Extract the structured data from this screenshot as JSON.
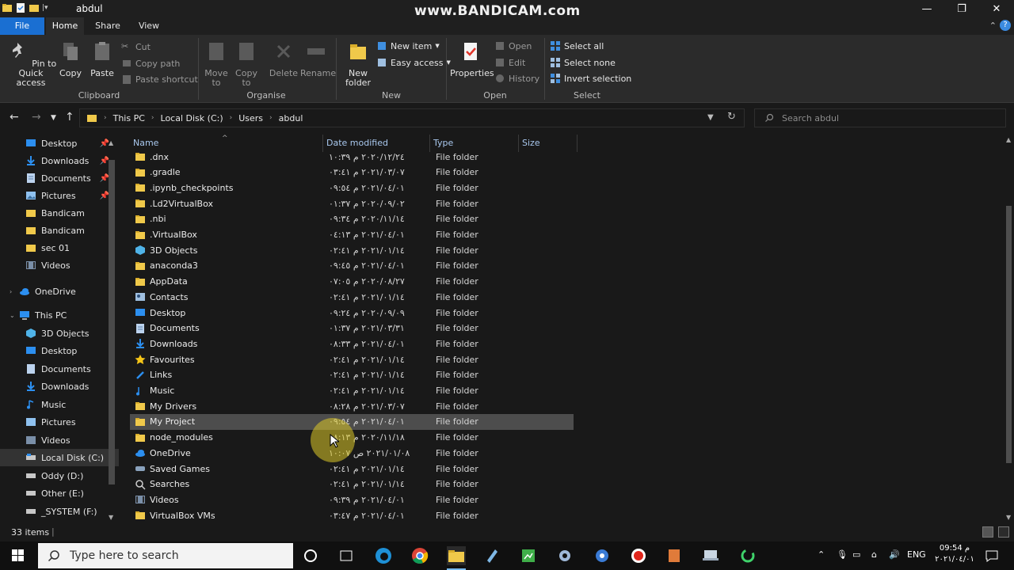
{
  "window": {
    "title": "abdul",
    "watermark": "www.BANDICAM.com",
    "minimize": "—",
    "restore": "❐",
    "close": "✕"
  },
  "tabs": {
    "file": "File",
    "home": "Home",
    "share": "Share",
    "view": "View"
  },
  "ribbon": {
    "clipboard": {
      "label": "Clipboard",
      "pin": "Pin to Quick access",
      "copy": "Copy",
      "paste": "Paste",
      "cut": "Cut",
      "copy_path": "Copy path",
      "paste_shortcut": "Paste shortcut"
    },
    "organise": {
      "label": "Organise",
      "move_to": "Move to",
      "copy_to": "Copy to",
      "delete": "Delete",
      "rename": "Rename"
    },
    "new": {
      "label": "New",
      "new_folder": "New folder",
      "new_item": "New item",
      "easy_access": "Easy access"
    },
    "open": {
      "label": "Open",
      "properties": "Properties",
      "open": "Open",
      "edit": "Edit",
      "history": "History"
    },
    "select": {
      "label": "Select",
      "select_all": "Select all",
      "select_none": "Select none",
      "invert": "Invert selection"
    }
  },
  "address": {
    "crumbs": [
      "This PC",
      "Local Disk (C:)",
      "Users",
      "abdul"
    ],
    "search_placeholder": "Search abdul"
  },
  "nav": {
    "quick_access": [
      {
        "label": "Desktop",
        "pinned": true,
        "icon": "desktop-icon"
      },
      {
        "label": "Downloads",
        "pinned": true,
        "icon": "downloads-icon"
      },
      {
        "label": "Documents",
        "pinned": true,
        "icon": "documents-icon"
      },
      {
        "label": "Pictures",
        "pinned": true,
        "icon": "pictures-icon"
      },
      {
        "label": "Bandicam",
        "pinned": false,
        "icon": "folder-icon"
      },
      {
        "label": "Bandicam",
        "pinned": false,
        "icon": "folder-icon"
      },
      {
        "label": "sec 01",
        "pinned": false,
        "icon": "folder-icon"
      },
      {
        "label": "Videos",
        "pinned": false,
        "icon": "videos-icon"
      }
    ],
    "onedrive": "OneDrive",
    "this_pc": "This PC",
    "this_pc_items": [
      {
        "label": "3D Objects",
        "icon": "3d-objects-icon"
      },
      {
        "label": "Desktop",
        "icon": "desktop-icon"
      },
      {
        "label": "Documents",
        "icon": "documents-icon"
      },
      {
        "label": "Downloads",
        "icon": "downloads-icon"
      },
      {
        "label": "Music",
        "icon": "music-icon"
      },
      {
        "label": "Pictures",
        "icon": "pictures-icon"
      },
      {
        "label": "Videos",
        "icon": "videos-icon"
      },
      {
        "label": "Local Disk (C:)",
        "icon": "drive-icon",
        "selected": true
      },
      {
        "label": "Oddy (D:)",
        "icon": "drive-icon"
      },
      {
        "label": "Other (E:)",
        "icon": "drive-icon"
      },
      {
        "label": "_SYSTEM (F:)",
        "icon": "drive-icon"
      }
    ]
  },
  "columns": {
    "name": "Name",
    "date": "Date modified",
    "type": "Type",
    "size": "Size"
  },
  "files": [
    {
      "name": ".dnx",
      "date": "٢٠٢٠/١٢/٢٤ م ١٠:٣٩",
      "type": "File folder",
      "icon": "folder-icon"
    },
    {
      "name": ".gradle",
      "date": "٢٠٢١/٠٣/٠٧ م ٠٣:٤١",
      "type": "File folder",
      "icon": "folder-icon"
    },
    {
      "name": ".ipynb_checkpoints",
      "date": "٢٠٢١/٠٤/٠١ م ٠٩:٥٤",
      "type": "File folder",
      "icon": "folder-icon"
    },
    {
      "name": ".Ld2VirtualBox",
      "date": "٢٠٢٠/٠٩/٠٢ م ٠١:٣٧",
      "type": "File folder",
      "icon": "folder-icon"
    },
    {
      "name": ".nbi",
      "date": "٢٠٢٠/١١/١٤ م ٠٩:٣٤",
      "type": "File folder",
      "icon": "folder-icon"
    },
    {
      "name": ".VirtualBox",
      "date": "٢٠٢١/٠٤/٠١ م ٠٤:١٣",
      "type": "File folder",
      "icon": "folder-icon"
    },
    {
      "name": "3D Objects",
      "date": "٢٠٢١/٠١/١٤ م ٠٢:٤١",
      "type": "File folder",
      "icon": "3d-objects-icon"
    },
    {
      "name": "anaconda3",
      "date": "٢٠٢١/٠٤/٠١ م ٠٩:٤٥",
      "type": "File folder",
      "icon": "folder-icon"
    },
    {
      "name": "AppData",
      "date": "٢٠٢٠/٠٨/٢٧ م ٠٧:٠٥",
      "type": "File folder",
      "icon": "folder-icon"
    },
    {
      "name": "Contacts",
      "date": "٢٠٢١/٠١/١٤ م ٠٢:٤١",
      "type": "File folder",
      "icon": "contacts-icon"
    },
    {
      "name": "Desktop",
      "date": "٢٠٢٠/٠٩/٠٩ م ٠٩:٢٤",
      "type": "File folder",
      "icon": "desktop-icon"
    },
    {
      "name": "Documents",
      "date": "٢٠٢١/٠٣/٣١ م ٠١:٣٧",
      "type": "File folder",
      "icon": "documents-icon"
    },
    {
      "name": "Downloads",
      "date": "٢٠٢١/٠٤/٠١ م ٠٨:٣٣",
      "type": "File folder",
      "icon": "downloads-icon"
    },
    {
      "name": "Favourites",
      "date": "٢٠٢١/٠١/١٤ م ٠٢:٤١",
      "type": "File folder",
      "icon": "star-icon"
    },
    {
      "name": "Links",
      "date": "٢٠٢١/٠١/١٤ م ٠٢:٤١",
      "type": "File folder",
      "icon": "links-icon"
    },
    {
      "name": "Music",
      "date": "٢٠٢١/٠١/١٤ م ٠٢:٤١",
      "type": "File folder",
      "icon": "music-icon"
    },
    {
      "name": "My Drivers",
      "date": "٢٠٢١/٠٣/٠٧ م ٠٨:٢٨",
      "type": "File folder",
      "icon": "folder-icon"
    },
    {
      "name": "My Project",
      "date": "٢٠٢١/٠٤/٠١ م ٠٩:٥٤",
      "type": "File folder",
      "icon": "folder-icon",
      "selected": true
    },
    {
      "name": "node_modules",
      "date": "٢٠٢٠/١١/١٨ م ٠٨:١٣",
      "type": "File folder",
      "icon": "folder-icon"
    },
    {
      "name": "OneDrive",
      "date": "٢٠٢١/٠١/٠٨ ص ١٠:٠٧",
      "type": "File folder",
      "icon": "onedrive-icon"
    },
    {
      "name": "Saved Games",
      "date": "٢٠٢١/٠١/١٤ م ٠٢:٤١",
      "type": "File folder",
      "icon": "saved-games-icon"
    },
    {
      "name": "Searches",
      "date": "٢٠٢١/٠١/١٤ م ٠٢:٤١",
      "type": "File folder",
      "icon": "search-icon"
    },
    {
      "name": "Videos",
      "date": "٢٠٢١/٠٤/٠١ م ٠٩:٣٩",
      "type": "File folder",
      "icon": "videos-icon"
    },
    {
      "name": "VirtualBox VMs",
      "date": "٢٠٢١/٠٤/٠١ م ٠٣:٤٧",
      "type": "File folder",
      "icon": "folder-icon"
    }
  ],
  "status": {
    "count": "33 items"
  },
  "taskbar": {
    "search_placeholder": "Type here to search",
    "lang": "ENG",
    "time": "09:54 م",
    "date": "٢٠٢١/٠٤/٠١"
  },
  "colors": {
    "accent": "#1a6fd2",
    "folder": "#f0c94a",
    "selected_row": "#4d4d4d"
  }
}
